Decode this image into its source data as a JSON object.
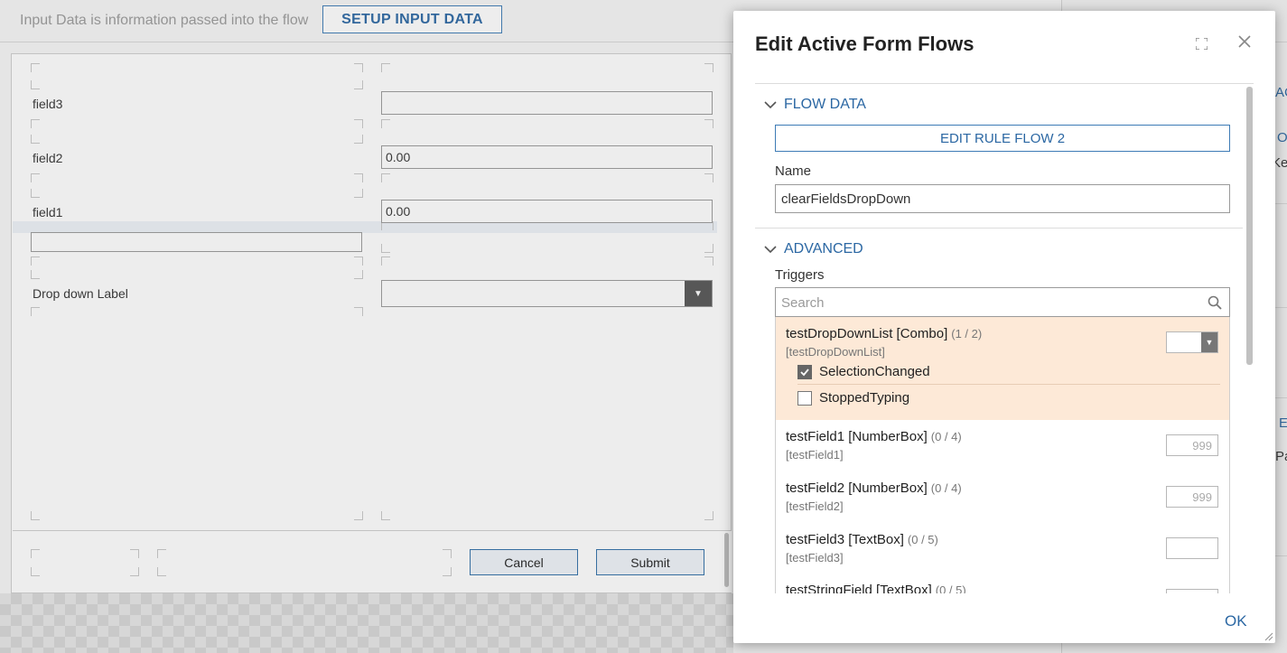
{
  "background": {
    "info_text": "Input Data is information passed into the flow",
    "setup_button": "SETUP INPUT DATA",
    "form": {
      "fields": [
        {
          "label": "field3",
          "value": ""
        },
        {
          "label": "field2",
          "value": "0.00"
        },
        {
          "label": "field1",
          "value": "0.00"
        }
      ],
      "dropdown_label": "Drop down Label",
      "cancel_label": "Cancel",
      "submit_label": "Submit"
    },
    "right_panel_fragments": [
      "AC",
      "O",
      "Ke",
      "E",
      "Pa"
    ]
  },
  "dialog": {
    "title": "Edit Active Form Flows",
    "sections": {
      "flow_data": "FLOW DATA",
      "advanced": "ADVANCED"
    },
    "edit_rule_button": "EDIT RULE FLOW 2",
    "name_label": "Name",
    "name_value": "clearFieldsDropDown",
    "triggers_label": "Triggers",
    "search_placeholder": "Search",
    "triggers": [
      {
        "name": "testDropDownList [Combo]",
        "count": "(1 / 2)",
        "id": "[testDropDownList]"
      },
      {
        "name": "testField1 [NumberBox]",
        "count": "(0 / 4)",
        "id": "[testField1]",
        "sample": "999"
      },
      {
        "name": "testField2 [NumberBox]",
        "count": "(0 / 4)",
        "id": "[testField2]",
        "sample": "999"
      },
      {
        "name": "testField3 [TextBox]",
        "count": "(0 / 5)",
        "id": "[testField3]"
      },
      {
        "name": "testStringField [TextBox]",
        "count": "(0 / 5)"
      }
    ],
    "events": [
      {
        "label": "SelectionChanged",
        "checked": true
      },
      {
        "label": "StoppedTyping",
        "checked": false
      }
    ],
    "ok_label": "OK"
  },
  "colors": {
    "accent": "#2b67a3",
    "active_row": "#fde9d7"
  }
}
